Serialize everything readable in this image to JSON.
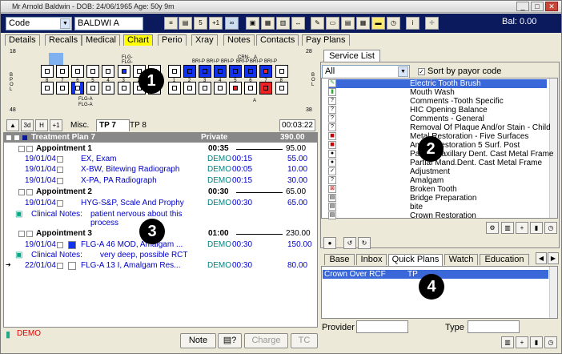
{
  "window": {
    "title": "Mr Arnold Baldwin - DOB: 24/06/1965 Age: 50y 9m"
  },
  "topbar": {
    "search_type": "Code",
    "search_value": "BALDWI A",
    "balance": "Bal: 0.00",
    "toolbar": [
      "5",
      "+1"
    ]
  },
  "tabs": [
    "Details",
    "Recalls",
    "Medical",
    "Chart",
    "Perio",
    "Xray",
    "Notes",
    "Contacts",
    "Pay Plans"
  ],
  "chart": {
    "left_top": "18",
    "right_top": "28",
    "left_bottom": "48",
    "right_bottom": "38",
    "letters_left": [
      "B",
      "P",
      "O",
      "L"
    ],
    "letters_right": [
      "B",
      "O",
      "L"
    ],
    "upper_labels": [
      "FLG-",
      "FLG-",
      "BRI-P",
      "BRI-P",
      "BRI-P",
      "CRN-",
      "BRI-P",
      "BRI-P",
      "A",
      "BRI-P"
    ],
    "lower_labels": [
      "FLG-A",
      "FLG-A",
      "A"
    ],
    "upper_nums": [
      "8",
      "7",
      "6",
      "5",
      "4",
      "3",
      "2",
      "1",
      "1",
      "2",
      "3",
      "4",
      "5",
      "6",
      "7",
      "8"
    ],
    "lower_nums": [
      "8",
      "7",
      "6",
      "5",
      "4",
      "3",
      "2",
      "1",
      "1",
      "2",
      "3",
      "4",
      "5",
      "6",
      "7",
      "8"
    ]
  },
  "plan": {
    "btn_3d": "3d",
    "btn_h": "H",
    "btn_plus": "+1",
    "misc": "Misc.",
    "tp7": "TP 7",
    "tp8": "TP 8",
    "time": "00:03:22",
    "header": {
      "name": "Treatment Plan 7",
      "type": "Private",
      "amount": "390.00"
    },
    "appt1": {
      "name": "Appointment 1",
      "time": "00:35",
      "amount": "95.00"
    },
    "r1": {
      "date": "19/01/04",
      "desc": "EX, Exam",
      "prov": "DEMO",
      "time": "00:15",
      "amount": "55.00"
    },
    "r2": {
      "date": "19/01/04",
      "desc": "X-BW, Bitewing Radiograph",
      "prov": "DEMO",
      "time": "00:05",
      "amount": "10.00"
    },
    "r3": {
      "date": "19/01/04",
      "desc": "X-PA, PA Radiograph",
      "prov": "DEMO",
      "time": "00:15",
      "amount": "30.00"
    },
    "appt2": {
      "name": "Appointment 2",
      "time": "00:30",
      "amount": "65.00"
    },
    "r4": {
      "date": "19/01/04",
      "desc": "HYG-S&P, Scale And Prophy",
      "prov": "DEMO",
      "time": "00:30",
      "amount": "65.00"
    },
    "note1": {
      "label": "Clinical Notes:",
      "line1": "patient nervous about this",
      "line2": "process"
    },
    "appt3": {
      "name": "Appointment 3",
      "time": "01:00",
      "amount": "230.00"
    },
    "r5": {
      "date": "19/01/04",
      "desc": "FLG-A  46  MOD, Amalgam ...",
      "prov": "DEMO",
      "time": "00:30",
      "amount": "150.00"
    },
    "note2": {
      "label": "Clinical Notes:",
      "line1": "very deep, possible RCT"
    },
    "r6": {
      "date": "22/01/04",
      "desc": "FLG-A  13  I, Amalgam Res...",
      "prov": "DEMO",
      "time": "00:30",
      "amount": "80.00"
    }
  },
  "footer": {
    "provider": "DEMO",
    "note": "Note",
    "charge": "Charge",
    "tc": "TC"
  },
  "service": {
    "tab": "Service List",
    "filter": "All",
    "sort_label": "Sort by payor code",
    "items": [
      "Electric Tooth Brush",
      "Mouth Wash",
      "Comments -Tooth Specific",
      "HIC Opening Balance",
      "Comments - General",
      "Removal Of Plaque And/or Stain - Child",
      "Metal Restoration - Five Surfaces",
      "Amalg Restoration 5 Surf. Post",
      "Partial Maxillary Dent. Cast Metal Frame",
      "Partial Mand.Dent. Cast Metal Frame",
      "Adjustment",
      "Amalgam",
      "Broken Tooth",
      "Bridge Preparation",
      "bite",
      "Crown Restoration"
    ]
  },
  "bottom_tabs": [
    "Base",
    "Inbox",
    "Quick Plans",
    "Watch",
    "Education"
  ],
  "quick": {
    "row_name": "Crown Over RCF",
    "row_code": "TP",
    "provider_label": "Provider",
    "type_label": "Type"
  },
  "callouts": [
    "1",
    "2",
    "3",
    "4"
  ]
}
